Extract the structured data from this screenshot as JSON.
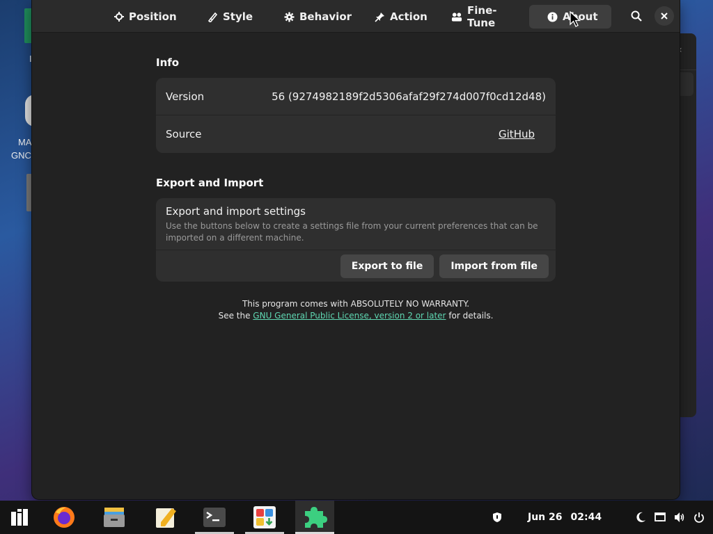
{
  "desktop": {
    "icon_label_1": "MA",
    "icon_label_2": "GNC",
    "letter_1": "I"
  },
  "headerbar": {
    "tabs": [
      {
        "label": "Position",
        "icon": "crosshair-icon"
      },
      {
        "label": "Style",
        "icon": "brush-icon"
      },
      {
        "label": "Behavior",
        "icon": "gear-icon"
      },
      {
        "label": "Action",
        "icon": "pin-icon"
      },
      {
        "label": "Fine-Tune",
        "icon": "tune-icon"
      },
      {
        "label": "About",
        "icon": "info-icon",
        "active": true
      }
    ],
    "search_icon": "search-icon",
    "close_icon": "close-icon"
  },
  "info": {
    "title": "Info",
    "version_label": "Version",
    "version_value": "56 (9274982189f2d5306afaf29f274d007f0cd12d48)",
    "source_label": "Source",
    "source_value": "GitHub"
  },
  "export_import": {
    "title": "Export and Import",
    "row_title": "Export and import settings",
    "row_subtitle": "Use the buttons below to create a settings file from your current preferences that can be imported on a different machine.",
    "export_button": "Export to file",
    "import_button": "Import from file"
  },
  "footer": {
    "line1": "This program comes with ABSOLUTELY NO WARRANTY.",
    "line2_prefix": "See the ",
    "license_link": "GNU General Public License, version 2 or later",
    "line2_suffix": " for details."
  },
  "taskbar": {
    "apps": [
      "app-menu-icon",
      "firefox-icon",
      "files-icon",
      "text-editor-icon",
      "terminal-icon",
      "software-center-icon",
      "extensions-icon"
    ],
    "date": "Jun 26",
    "time": "02:44"
  },
  "colors": {
    "accent_link": "#5fd7b2",
    "window_bg": "#222222",
    "card_bg": "#2f2f2f",
    "taskbar_bg": "#141414"
  }
}
